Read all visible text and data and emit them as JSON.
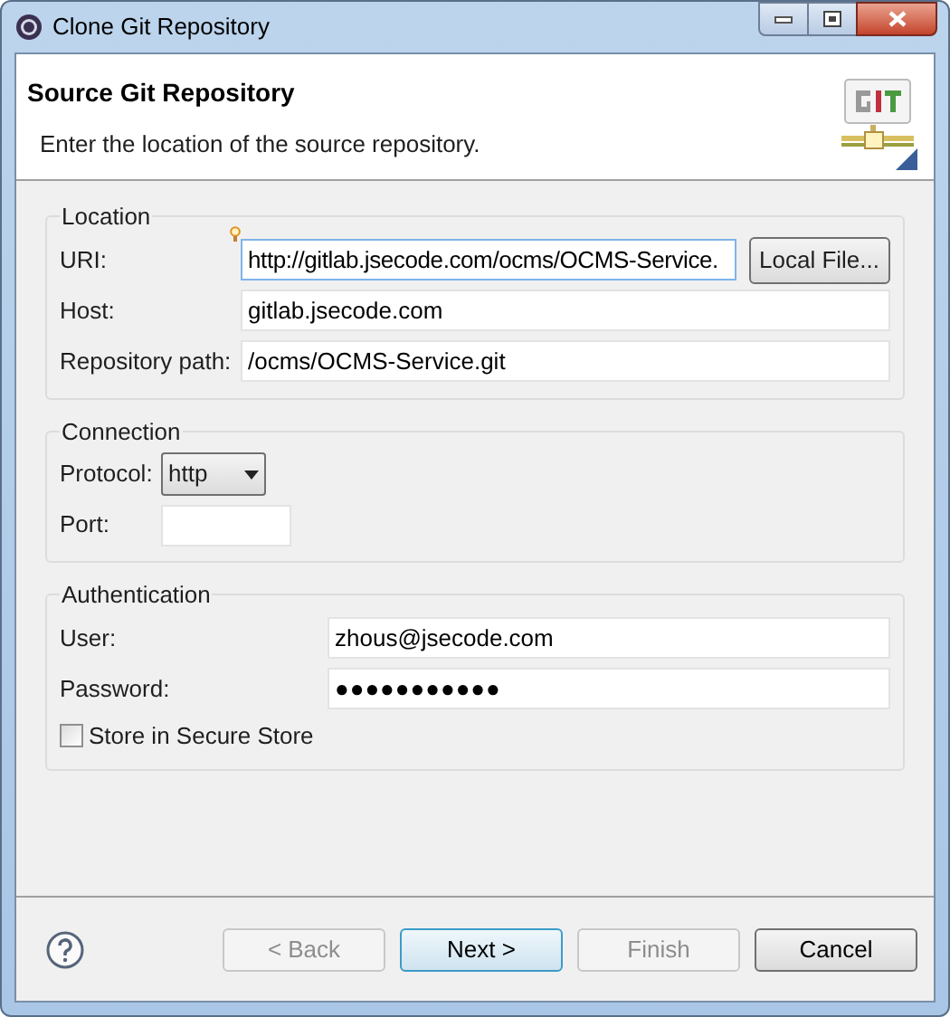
{
  "window": {
    "title": "Clone Git Repository"
  },
  "header": {
    "title": "Source Git Repository",
    "description": "Enter the location of the source repository."
  },
  "groups": [
    {
      "title": "Location",
      "rows": [
        {
          "kind": "text",
          "label": "URI:",
          "value": "http://gitlab.jsecode.com/ocms/OCMS-Service.",
          "hint": true,
          "focused": true,
          "button": "Local File..."
        },
        {
          "kind": "text",
          "label": "Host:",
          "value": "gitlab.jsecode.com",
          "hint": false,
          "focused": false
        },
        {
          "kind": "text",
          "label": "Repository path:",
          "value": "/ocms/OCMS-Service.git",
          "hint": false,
          "focused": false
        }
      ]
    },
    {
      "title": "Connection",
      "rows": [
        {
          "kind": "select",
          "label": "Protocol:",
          "value": "http"
        },
        {
          "kind": "short",
          "label": "Port:"
        }
      ]
    },
    {
      "title": "Authentication",
      "rows": [
        {
          "kind": "text",
          "label": "User:",
          "value": "zhous@jsecode.com",
          "hint": false,
          "focused": false
        },
        {
          "kind": "password",
          "label": "Password:",
          "value": "●●●●●●●●●●●"
        },
        {
          "kind": "checkbox",
          "label": "Store in Secure Store",
          "checked": false
        }
      ]
    }
  ],
  "buttons": [
    {
      "label": "< Back",
      "disabled": true,
      "default": false
    },
    {
      "label": "Next >",
      "disabled": false,
      "default": true
    },
    {
      "label": "Finish",
      "disabled": true,
      "default": false
    },
    {
      "label": "Cancel",
      "disabled": false,
      "default": false
    }
  ]
}
